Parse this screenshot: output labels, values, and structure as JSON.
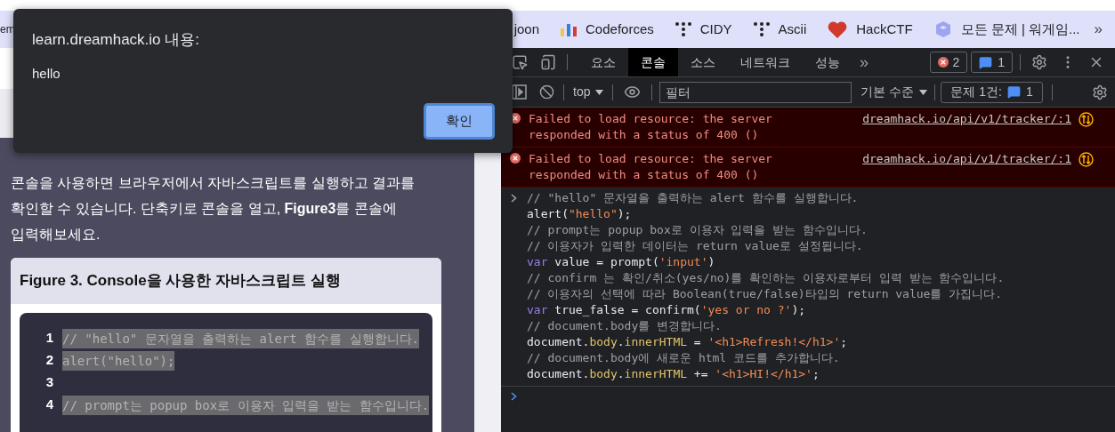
{
  "bookmarks": [
    {
      "label": "em",
      "kind": "plain"
    },
    {
      "label": "joon",
      "kind": "plain"
    },
    {
      "label": "Codeforces",
      "kind": "bars"
    },
    {
      "label": "CIDY",
      "kind": "dots"
    },
    {
      "label": "Ascii",
      "kind": "dots"
    },
    {
      "label": "HackCTF",
      "kind": "heart"
    },
    {
      "label": "모든 문제 | 워게임...",
      "kind": "cube"
    }
  ],
  "bookmarks_more": "»",
  "dialog": {
    "title": "learn.dreamhack.io 내용:",
    "message": "hello",
    "button": "확인"
  },
  "page": {
    "paragraph": "콘솔을 사용하면 브라우저에서 자바스크립트를 실행하고 결과를 확인할 수 있습니다. 단축키로 콘솔을 열고, **Figure3**를 콘솔에 입력해보세요.",
    "figure_title": "Figure 3. Console을 사용한 자바스크립트 실행",
    "code_lines": [
      {
        "number": "1",
        "text": "// \"hello\" 문자열을 출력하는 alert 함수를 실행합니다.",
        "selected": true
      },
      {
        "number": "2",
        "text": "alert(\"hello\");",
        "selected": true
      },
      {
        "number": "3",
        "selected": false
      },
      {
        "number": "4",
        "text": "// prompt는 popup box로 이용자 입력을 받는 함수입니다.",
        "selected": true
      }
    ]
  },
  "devtools": {
    "tabs": [
      {
        "label": "요소",
        "selected": false
      },
      {
        "label": "콘솔",
        "selected": true
      },
      {
        "label": "소스",
        "selected": false
      },
      {
        "label": "네트워크",
        "selected": false
      },
      {
        "label": "성능",
        "selected": false
      }
    ],
    "tabs_more": "»",
    "error_count": "2",
    "info_count": "1",
    "context": "top",
    "filter_placeholder": "필터",
    "level": "기본 수준",
    "issues_label": "문제 1건:",
    "issues_count": "1",
    "messages": [
      {
        "kind": "error",
        "text": "Failed to load resource: the server responded with a status of 400 ()",
        "source": "dreamhack.io/api/v1/tracker/:1"
      },
      {
        "kind": "error",
        "text": "Failed to load resource: the server responded with a status of 400 ()",
        "source": "dreamhack.io/api/v1/tracker/:1"
      }
    ],
    "input_lines": [
      [
        {
          "kind": "comment",
          "text": "// \"hello\" 문자열을 출력하는 alert 함수를 실행합니다."
        }
      ],
      [
        {
          "kind": "plain",
          "text": "alert("
        },
        {
          "kind": "string",
          "text": "\"hello\""
        },
        {
          "kind": "plain",
          "text": ");"
        }
      ],
      [
        {
          "kind": "comment",
          "text": "// prompt는 popup box로 이용자 입력을 받는 함수입니다."
        }
      ],
      [
        {
          "kind": "comment",
          "text": "// 이용자가 입력한 데이터는 return value로 설정됩니다."
        }
      ],
      [
        {
          "kind": "keyword",
          "text": "var"
        },
        {
          "kind": "plain",
          "text": " value = prompt("
        },
        {
          "kind": "string",
          "text": "'input'"
        },
        {
          "kind": "plain",
          "text": ")"
        }
      ],
      [
        {
          "kind": "comment",
          "text": "// confirm 는 확인/취소(yes/no)를 확인하는 이용자로부터 입력 받는 함수입니다."
        }
      ],
      [
        {
          "kind": "comment",
          "text": "// 이용자의 선택에 따라 Boolean(true/false)타입의 return value를 가집니다."
        }
      ],
      [
        {
          "kind": "keyword",
          "text": "var"
        },
        {
          "kind": "plain",
          "text": " true_false = confirm("
        },
        {
          "kind": "string",
          "text": "'yes or no ?'"
        },
        {
          "kind": "plain",
          "text": ");"
        }
      ],
      [
        {
          "kind": "comment",
          "text": "// document.body를 변경합니다."
        }
      ],
      [
        {
          "kind": "plain",
          "text": "document."
        },
        {
          "kind": "property",
          "text": "body"
        },
        {
          "kind": "plain",
          "text": "."
        },
        {
          "kind": "property",
          "text": "innerHTML"
        },
        {
          "kind": "plain",
          "text": " = "
        },
        {
          "kind": "string",
          "text": "'<h1>Refresh!</h1>'"
        },
        {
          "kind": "plain",
          "text": ";"
        }
      ],
      [
        {
          "kind": "comment",
          "text": "// document.body에 새로운 html 코드를 추가합니다."
        }
      ],
      [
        {
          "kind": "plain",
          "text": "document."
        },
        {
          "kind": "property",
          "text": "body"
        },
        {
          "kind": "plain",
          "text": "."
        },
        {
          "kind": "property",
          "text": "innerHTML"
        },
        {
          "kind": "plain",
          "text": " += "
        },
        {
          "kind": "string",
          "text": "'<h1>HI!</h1>'"
        },
        {
          "kind": "plain",
          "text": ";"
        }
      ]
    ]
  }
}
